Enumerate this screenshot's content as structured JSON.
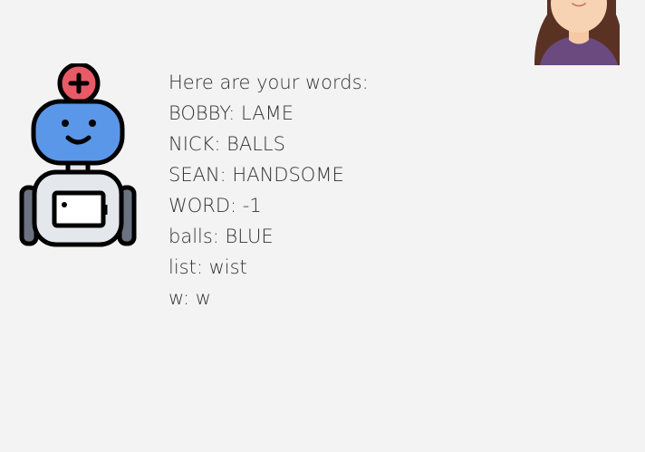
{
  "chat": {
    "intro": "Here are your words:",
    "words": [
      "BOBBY: LAME",
      "NICK: BALLS",
      "SEAN: HANDSOME",
      "WORD: -1",
      "balls: BLUE",
      "list: wist",
      "w: w"
    ]
  },
  "icons": {
    "bot": "robot-avatar-icon",
    "user": "user-avatar-icon"
  },
  "colors": {
    "background": "#f3f3f3",
    "text": "#333333",
    "bot_head": "#5b97e8",
    "bot_badge": "#e95a67",
    "bot_body": "#e4e7ec",
    "user_hair": "#5a3224",
    "user_skin": "#f4c9a4",
    "user_shirt": "#6b4a80"
  }
}
